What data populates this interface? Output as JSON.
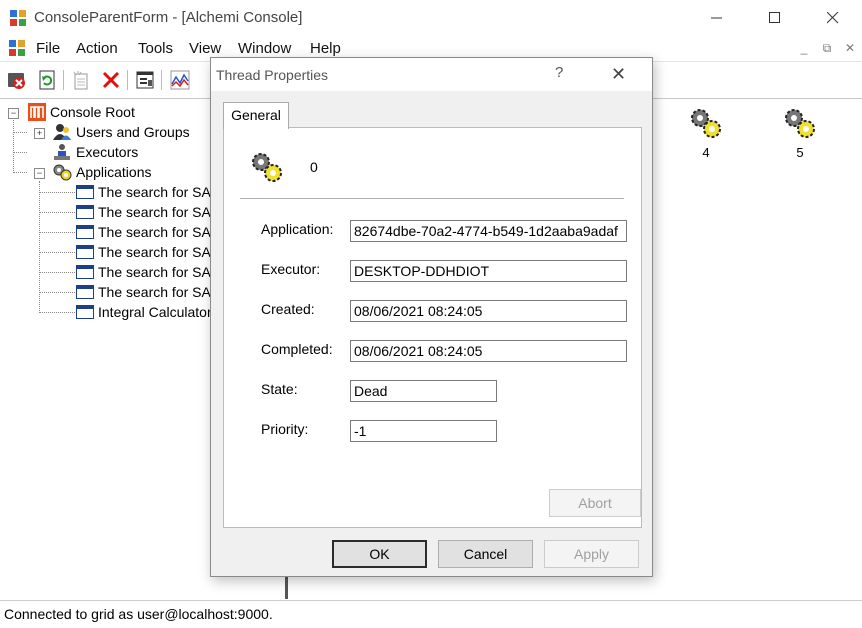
{
  "window": {
    "title": "ConsoleParentForm - [Alchemi Console]"
  },
  "menu": [
    "File",
    "Action",
    "Tools",
    "View",
    "Window",
    "Help"
  ],
  "mdi_controls": [
    "_",
    "⧉",
    "✕"
  ],
  "toolbar": {
    "icons": [
      "disconnect-icon",
      "refresh-icon",
      "new-icon",
      "delete-icon",
      "properties-icon",
      "performance-icon"
    ]
  },
  "tree": {
    "root": "Console Root",
    "users": "Users and Groups",
    "executors": "Executors",
    "applications": "Applications",
    "apps": [
      "The search for SA",
      "The search for SA",
      "The search for SA",
      "The search for SA",
      "The search for SA",
      "The search for SA",
      "Integral Calculator"
    ]
  },
  "threads": [
    "4",
    "5"
  ],
  "status": "Connected to grid as user@localhost:9000.",
  "dialog": {
    "title": "Thread Properties",
    "help": "?",
    "close": "✕",
    "tab": "General",
    "thread_id": "0",
    "fields": {
      "application_label": "Application:",
      "application_value": "82674dbe-70a2-4774-b549-1d2aaba9adaf",
      "executor_label": "Executor:",
      "executor_value": "DESKTOP-DDHDIOT",
      "created_label": "Created:",
      "created_value": "08/06/2021 08:24:05",
      "completed_label": "Completed:",
      "completed_value": "08/06/2021 08:24:05",
      "state_label": "State:",
      "state_value": "Dead",
      "priority_label": "Priority:",
      "priority_value": "-1"
    },
    "buttons": {
      "abort": "Abort",
      "ok": "OK",
      "cancel": "Cancel",
      "apply": "Apply"
    }
  },
  "colors": {
    "accent": "#1c3f8a",
    "alchemi_logo": "#e8501a"
  }
}
